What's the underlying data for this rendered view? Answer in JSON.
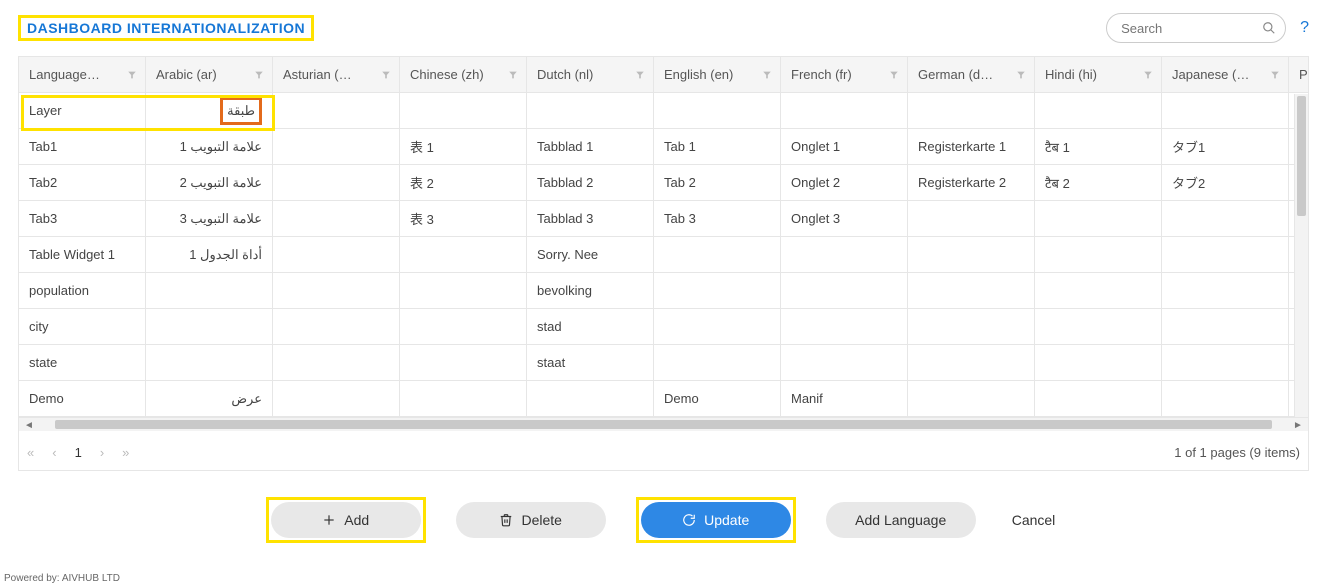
{
  "header": {
    "title": "DASHBOARD INTERNATIONALIZATION",
    "search_placeholder": "Search",
    "help": "?"
  },
  "grid": {
    "columns": [
      "Language…",
      "Arabic (ar)",
      "Asturian (…",
      "Chinese (zh)",
      "Dutch (nl)",
      "English (en)",
      "French (fr)",
      "German (d…",
      "Hindi (hi)",
      "Japanese (…",
      "P"
    ],
    "rows": [
      {
        "key": "Layer",
        "ar": "طبقة",
        "ast": "",
        "zh": "",
        "nl": "",
        "en": "",
        "fr": "",
        "de": "",
        "hi": "",
        "ja": "",
        "editing": true
      },
      {
        "key": "Tab1",
        "ar": "علامة التبويب 1",
        "ast": "",
        "zh": "表 1",
        "nl": "Tabblad 1",
        "en": "Tab 1",
        "fr": "Onglet 1",
        "de": "Registerkarte 1",
        "hi": "टैब 1",
        "ja": "タブ1"
      },
      {
        "key": "Tab2",
        "ar": "علامة التبويب 2",
        "ast": "",
        "zh": "表 2",
        "nl": "Tabblad 2",
        "en": "Tab 2",
        "fr": "Onglet 2",
        "de": "Registerkarte 2",
        "hi": "टैब 2",
        "ja": "タブ2"
      },
      {
        "key": "Tab3",
        "ar": "علامة التبويب 3",
        "ast": "",
        "zh": "表 3",
        "nl": "Tabblad 3",
        "en": "Tab 3",
        "fr": "Onglet 3",
        "de": "",
        "hi": "",
        "ja": ""
      },
      {
        "key": "Table Widget 1",
        "ar": "أداة الجدول 1",
        "ast": "",
        "zh": "",
        "nl": "Sorry. Nee",
        "en": "",
        "fr": "",
        "de": "",
        "hi": "",
        "ja": ""
      },
      {
        "key": "population",
        "ar": "",
        "ast": "",
        "zh": "",
        "nl": "bevolking",
        "en": "",
        "fr": "",
        "de": "",
        "hi": "",
        "ja": ""
      },
      {
        "key": "city",
        "ar": "",
        "ast": "",
        "zh": "",
        "nl": "stad",
        "en": "",
        "fr": "",
        "de": "",
        "hi": "",
        "ja": ""
      },
      {
        "key": "state",
        "ar": "",
        "ast": "",
        "zh": "",
        "nl": "staat",
        "en": "",
        "fr": "",
        "de": "",
        "hi": "",
        "ja": ""
      },
      {
        "key": "Demo",
        "ar": "عرض",
        "ast": "",
        "zh": "",
        "nl": "",
        "en": "Demo",
        "fr": "Manif",
        "de": "",
        "hi": "",
        "ja": ""
      }
    ]
  },
  "pager": {
    "page": "1",
    "info": "1 of 1 pages (9 items)"
  },
  "actions": {
    "add": "Add",
    "delete": "Delete",
    "update": "Update",
    "add_language": "Add Language",
    "cancel": "Cancel"
  },
  "footer": "Powered by: AIVHUB LTD"
}
